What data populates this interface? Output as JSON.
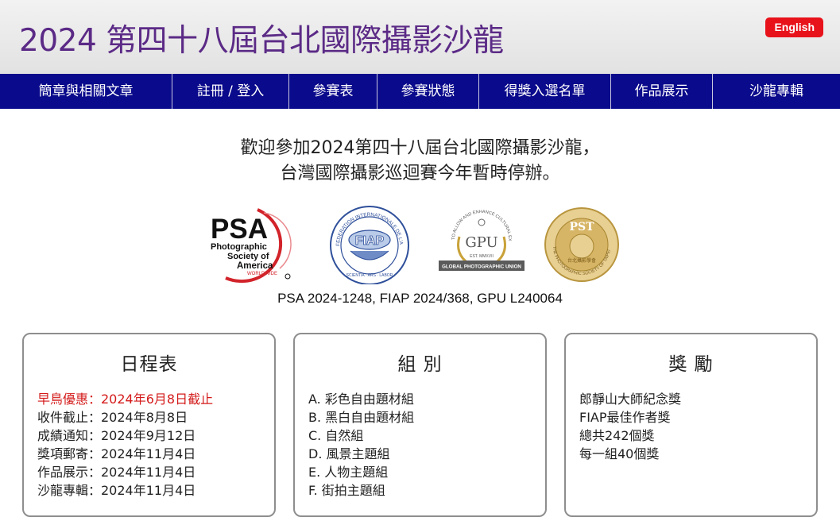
{
  "header": {
    "title": "2024 第四十八屆台北國際攝影沙龍",
    "lang_button": "English"
  },
  "nav": {
    "items": [
      {
        "label": "簡章與相關文章"
      },
      {
        "label": "註冊 / 登入"
      },
      {
        "label": "參賽表"
      },
      {
        "label": "參賽狀態"
      },
      {
        "label": "得獎入選名單"
      },
      {
        "label": "作品展示"
      },
      {
        "label": "沙龍專輯"
      }
    ]
  },
  "welcome": {
    "line1": "歡迎參加2024第四十八屆台北國際攝影沙龍，",
    "line2": "台灣國際攝影巡迴賽今年暫時停辦。"
  },
  "logos": {
    "psa": {
      "big": "PSA",
      "line1": "Photographic",
      "line2": "Society of",
      "line3": "America",
      "line4": "WORLDWIDE"
    },
    "fiap": {
      "arc": "FEDERATION INTERNATIONALE DE L'ART PHOTOGRAPHIQUE",
      "center": "FIAP",
      "motto": "SCIENTIA · ARS · LABOR"
    },
    "gpu": {
      "arc": "TO ALLOW AND ENHANCE CULTURAL EXCHANGE",
      "center": "GPU",
      "est": "EST. MMXVII",
      "banner": "GLOBAL PHOTOGRAPHIC UNION"
    },
    "pst": {
      "center": "PST",
      "chinese": "台北攝影學會",
      "arc": "THE PHOTOGRAPHIC SOCIETY OF TAIPEI"
    }
  },
  "patronage": "PSA 2024-1248, FIAP 2024/368, GPU L240064",
  "cards": {
    "schedule": {
      "title": "日程表",
      "items": [
        {
          "text": "早鳥優惠：2024年6月8日截止"
        },
        {
          "text": "收件截止：2024年8月8日"
        },
        {
          "text": "成績通知：2024年9月12日"
        },
        {
          "text": "獎項郵寄：2024年11月4日"
        },
        {
          "text": "作品展示：2024年11月4日"
        },
        {
          "text": "沙龍專輯：2024年11月4日"
        }
      ]
    },
    "sections": {
      "title": "組 別",
      "items": [
        {
          "text": "A. 彩色自由題材組"
        },
        {
          "text": "B. 黑白自由題材組"
        },
        {
          "text": "C. 自然組"
        },
        {
          "text": "D. 風景主題組"
        },
        {
          "text": "E. 人物主題組"
        },
        {
          "text": "F. 街拍主題組"
        }
      ]
    },
    "awards": {
      "title": "獎 勵",
      "items": [
        {
          "text": "郎靜山大師紀念獎"
        },
        {
          "text": "FIAP最佳作者獎"
        },
        {
          "text": "總共242個獎"
        },
        {
          "text": "每一組40個獎"
        }
      ]
    }
  },
  "colors": {
    "title": "#5b2a86",
    "nav_bg": "#0a0a8c",
    "lang_button": "#e8121b",
    "highlight": "#d41a1a"
  }
}
